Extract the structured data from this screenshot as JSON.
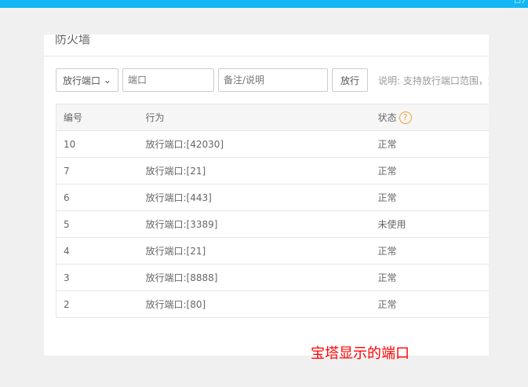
{
  "panel": {
    "title": "防火墙"
  },
  "toolbar": {
    "select_value": "放行端口",
    "port_placeholder": "端口",
    "remark_placeholder": "备注/说明",
    "submit_label": "放行",
    "note": "说明: 支持放行端口范围，如"
  },
  "table": {
    "headers": [
      "编号",
      "行为",
      "状态"
    ],
    "rows": [
      {
        "id": "10",
        "action": "放行端口:[42030]",
        "status": "正常"
      },
      {
        "id": "7",
        "action": "放行端口:[21]",
        "status": "正常"
      },
      {
        "id": "6",
        "action": "放行端口:[443]",
        "status": "正常"
      },
      {
        "id": "5",
        "action": "放行端口:[3389]",
        "status": "未使用"
      },
      {
        "id": "4",
        "action": "放行端口:[21]",
        "status": "正常"
      },
      {
        "id": "3",
        "action": "放行端口:[8888]",
        "status": "正常"
      },
      {
        "id": "2",
        "action": "放行端口:[80]",
        "status": "正常"
      }
    ]
  },
  "caption": "宝塔显示的端口"
}
